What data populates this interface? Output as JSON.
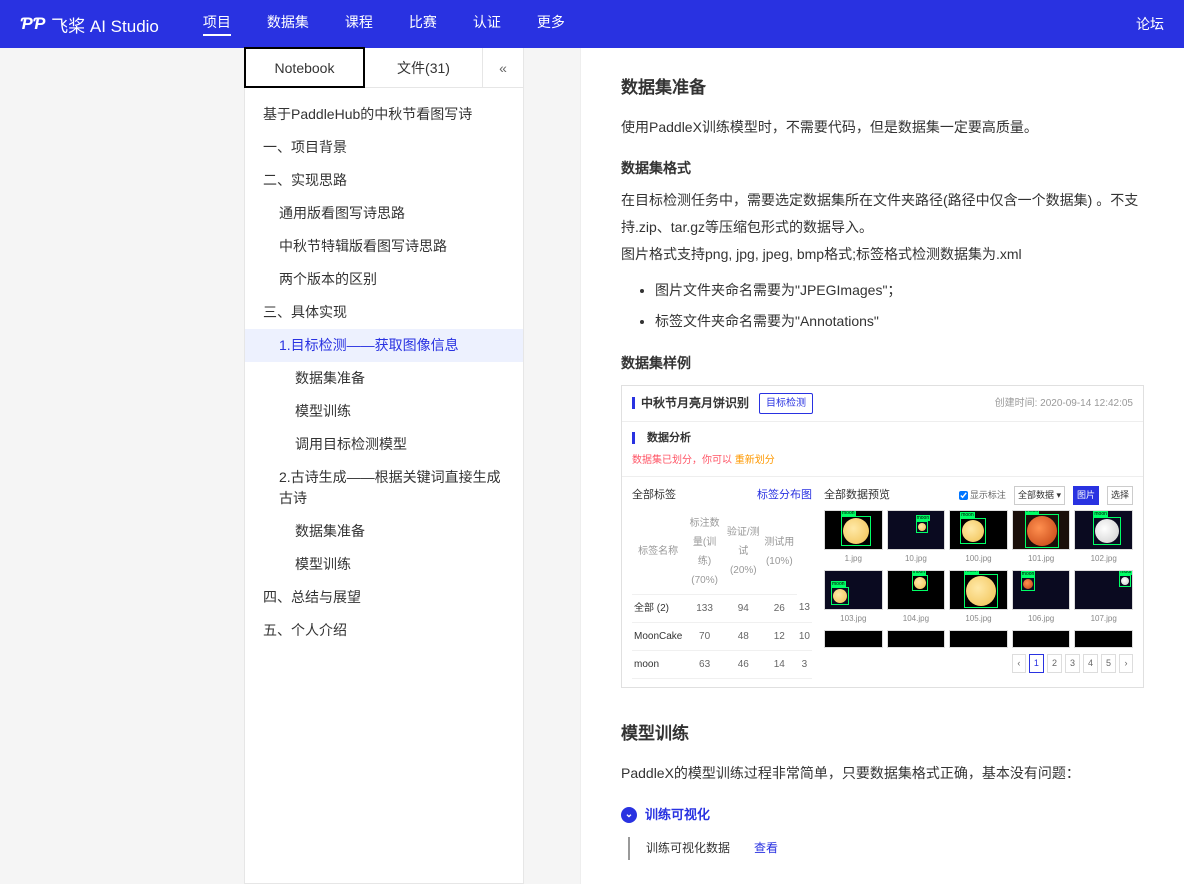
{
  "brand": "飞桨 AI Studio",
  "nav": [
    "项目",
    "数据集",
    "课程",
    "比赛",
    "认证",
    "更多"
  ],
  "forum": "论坛",
  "tabs": {
    "notebook": "Notebook",
    "files": "文件(31)"
  },
  "toc": [
    {
      "t": "基于PaddleHub的中秋节看图写诗",
      "lvl": 1
    },
    {
      "t": "一、项目背景",
      "lvl": 1
    },
    {
      "t": "二、实现思路",
      "lvl": 1
    },
    {
      "t": "通用版看图写诗思路",
      "lvl": 2
    },
    {
      "t": "中秋节特辑版看图写诗思路",
      "lvl": 2
    },
    {
      "t": "两个版本的区别",
      "lvl": 2
    },
    {
      "t": "三、具体实现",
      "lvl": 1
    },
    {
      "t": "1.目标检测——获取图像信息",
      "lvl": 2,
      "active": true
    },
    {
      "t": "数据集准备",
      "lvl": 3
    },
    {
      "t": "模型训练",
      "lvl": 3
    },
    {
      "t": "调用目标检测模型",
      "lvl": 3
    },
    {
      "t": "2.古诗生成——根据关键词直接生成古诗",
      "lvl": 2
    },
    {
      "t": "数据集准备",
      "lvl": 3
    },
    {
      "t": "模型训练",
      "lvl": 3
    },
    {
      "t": "四、总结与展望",
      "lvl": 1
    },
    {
      "t": "五、个人介绍",
      "lvl": 1
    }
  ],
  "article": {
    "h_dataset": "数据集准备",
    "p_intro": "使用PaddleX训练模型时，不需要代码，但是数据集一定要高质量。",
    "h_format": "数据集格式",
    "p_format1": "在目标检测任务中，需要选定数据集所在文件夹路径(路径中仅含一个数据集) 。不支持.zip、tar.gz等压缩包形式的数据导入。",
    "p_format2": "图片格式支持png, jpg, jpeg, bmp格式;标签格式检测数据集为.xml",
    "li1": "图片文件夹命名需要为\"JPEGImages\"；",
    "li2": "标签文件夹命名需要为\"Annotations\"",
    "h_sample": "数据集样例",
    "h_train": "模型训练",
    "p_train": "PaddleX的模型训练过程非常简单，只要数据集格式正确，基本没有问题：",
    "viz_title": "训练可视化",
    "viz_row_label": "训练可视化数据",
    "viz_row_link": "查看"
  },
  "card": {
    "title": "中秋节月亮月饼识别",
    "tab": "目标检测",
    "time": "创建时间: 2020-09-14 12:42:05",
    "section": "数据分析",
    "meta_red": "数据集已划分，你可以",
    "meta_orange": "重新划分",
    "left_title": "全部标签",
    "left_link": "标签分布图",
    "right_title": "全部数据预览",
    "right_check": "显示标注",
    "right_sel1": "全部数据 ▾",
    "right_sel2": "图片",
    "right_grid": "选择",
    "cols": [
      "标签名称",
      "标注数量(训练)(70%)",
      "验证/测试(20%)",
      "测试用(10%)"
    ],
    "rows": [
      {
        "name": "全部 (2)",
        "v": [
          "133",
          "94",
          "26",
          "13"
        ]
      },
      {
        "name": "MoonCake",
        "v": [
          "70",
          "48",
          "12",
          "10"
        ]
      },
      {
        "name": "moon",
        "v": [
          "63",
          "46",
          "14",
          "3"
        ]
      }
    ],
    "thumbs": [
      "1.jpg",
      "10.jpg",
      "100.jpg",
      "101.jpg",
      "102.jpg",
      "103.jpg",
      "104.jpg",
      "105.jpg",
      "106.jpg",
      "107.jpg"
    ],
    "pages": [
      "1",
      "2",
      "3",
      "4",
      "5"
    ]
  }
}
